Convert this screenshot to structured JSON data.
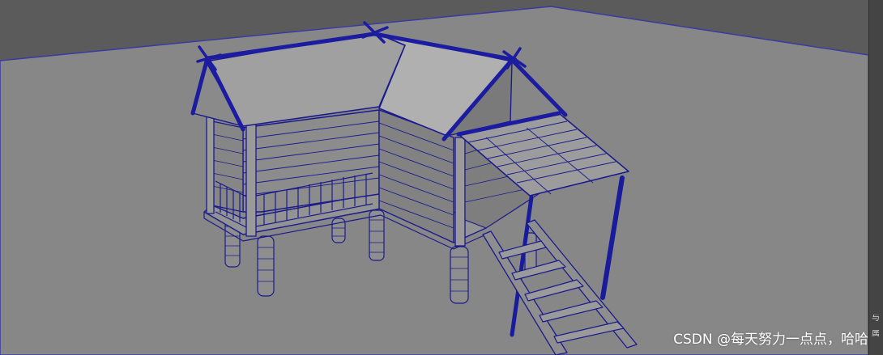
{
  "scene": {
    "subject": "stilt-house-wireframe",
    "background_color": "#5b5b5b",
    "floor_color": "#878787",
    "wire_color": "#1a1a8c",
    "roof_color": "#a3a3a3",
    "wall_color": "#8a8a8a"
  },
  "side_panel": {
    "glyph_top": "与",
    "glyph_bottom": "属"
  },
  "watermark": {
    "text": "CSDN @每天努力一点点，哈哈"
  }
}
